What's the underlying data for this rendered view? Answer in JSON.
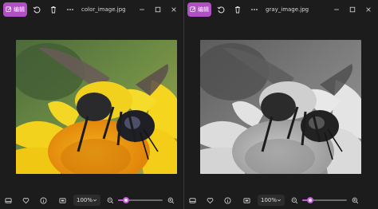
{
  "left_window": {
    "edit_label": "编辑",
    "filename": "color_image.jpg",
    "zoom": "100%",
    "zoom_slider_fraction": 0.18
  },
  "right_window": {
    "edit_label": "编辑",
    "filename": "gray_image.jpg",
    "zoom": "100%",
    "zoom_slider_fraction": 0.18
  },
  "colors": {
    "accent": "#b14fc5",
    "window_bg": "#1c1c1c"
  },
  "icons": {
    "toolbar": [
      "edit-icon",
      "rotate-icon",
      "delete-icon",
      "more-icon"
    ],
    "window": [
      "minimize-icon",
      "maximize-icon",
      "close-icon"
    ],
    "bottom": [
      "filmstrip-icon",
      "favorite-icon",
      "info-icon",
      "fit-window-icon",
      "zoom-out-icon",
      "zoom-in-icon"
    ]
  }
}
